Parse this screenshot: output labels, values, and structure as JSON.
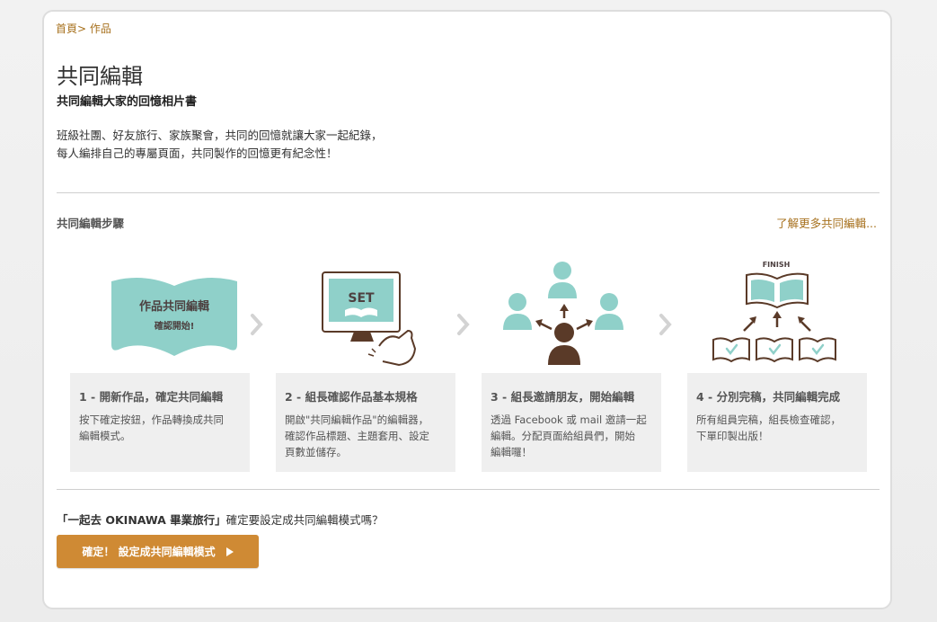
{
  "breadcrumb": {
    "home": "首頁",
    "separator": ">",
    "current": "作品"
  },
  "header": {
    "title": "共同編輯",
    "subtitle": "共同編輯大家的回憶相片書",
    "desc_line1": "班級社團、好友旅行、家族聚會，共同的回憶就讓大家一起紀錄，",
    "desc_line2": "每人編排自己的專屬頁面，共同製作的回憶更有紀念性！"
  },
  "steps_section": {
    "title": "共同編輯步驟",
    "learn_more": "了解更多共同編輯..."
  },
  "illustrations": {
    "book_line1": "作品共同編輯",
    "book_line2": "確認開始!",
    "screen_label": "SET",
    "finish_label": "FINISH"
  },
  "steps": [
    {
      "title": "1 - 開新作品，確定共同編輯",
      "desc": [
        "按下確定按鈕，作品轉換成共同",
        "編輯模式。"
      ]
    },
    {
      "title": "2 - 組長確認作品基本規格",
      "desc": [
        "開啟\"共同編輯作品\"的編輯器，",
        "確認作品標題、主題套用、設定",
        "頁數並儲存。"
      ]
    },
    {
      "title": "3 - 組長邀請朋友，開始編輯",
      "desc": [
        "透過 Facebook 或 mail 邀請一起",
        "編輯。分配頁面給組員們，開始",
        "編輯囉！"
      ]
    },
    {
      "title": "4 - 分別完稿，共同編輯完成",
      "desc": [
        "所有組員完稿，組長檢查確認，",
        "下單印製出版！"
      ]
    }
  ],
  "confirm": {
    "project_name": "「一起去 OKINAWA 畢業旅行」",
    "question": "確定要設定成共同編輯模式嗎？",
    "button_label": "確定！ 設定成共同編輯模式"
  },
  "colors": {
    "accent": "#a7711e",
    "teal": "#8fd0c9",
    "brown": "#5a3a28",
    "button": "#cf8a34"
  }
}
